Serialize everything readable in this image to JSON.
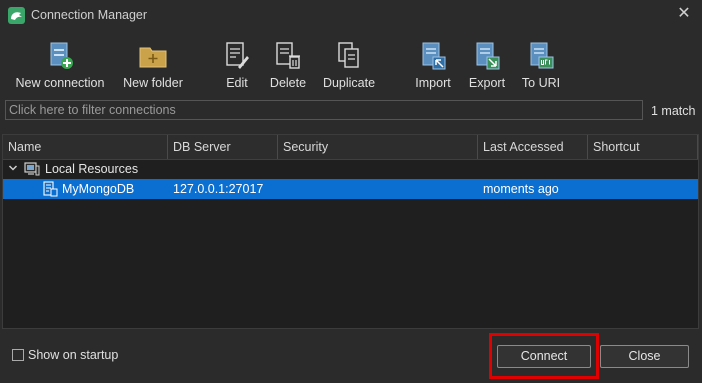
{
  "window": {
    "title": "Connection Manager",
    "close_icon": "close-icon",
    "app_icon": "robo3t-icon"
  },
  "toolbar": {
    "new_connection": "New connection",
    "new_folder": "New folder",
    "edit": "Edit",
    "delete": "Delete",
    "duplicate": "Duplicate",
    "import": "Import",
    "export": "Export",
    "to_uri": "To URI"
  },
  "filter": {
    "placeholder": "Click here to filter connections",
    "value": "",
    "match_count": "1 match"
  },
  "table": {
    "columns": [
      "Name",
      "DB Server",
      "Security",
      "Last Accessed",
      "Shortcut"
    ],
    "group": {
      "label": "Local Resources",
      "expanded": true
    },
    "rows": [
      {
        "name": "MyMongoDB",
        "db_server": "127.0.0.1:27017",
        "security": "",
        "last_accessed": "moments ago",
        "shortcut": "",
        "selected": true
      }
    ]
  },
  "footer": {
    "show_on_startup_label": "Show on startup",
    "show_on_startup_checked": false,
    "connect_label": "Connect",
    "close_label": "Close"
  },
  "colors": {
    "selection": "#0a6fd1",
    "highlight_box": "#e00000",
    "background": "#2b2b2b"
  }
}
